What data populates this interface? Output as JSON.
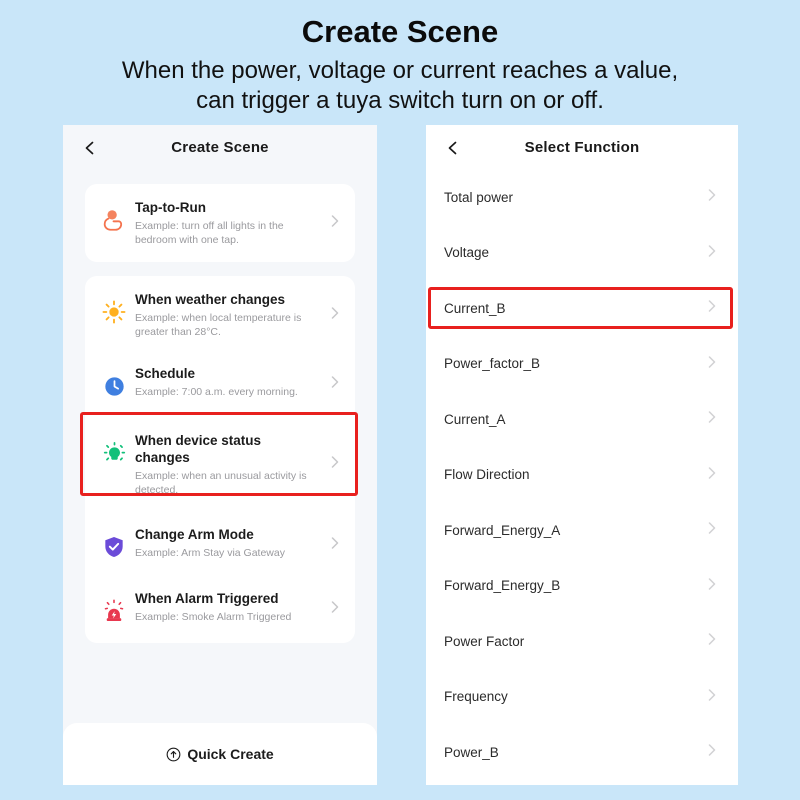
{
  "header": {
    "title": "Create Scene",
    "subtitle_line1": "When the power, voltage or current reaches a value,",
    "subtitle_line2": "can trigger a tuya switch turn on or off."
  },
  "colors": {
    "page_background": "#c9e6f9",
    "panel_background": "#f5f7fa",
    "card_background": "#ffffff",
    "highlight_red": "#e8201e",
    "tap_icon": "#f4734e",
    "weather_icon": "#ffb01f",
    "schedule_icon": "#3f7fe0",
    "device_icon": "#12c07a",
    "arm_icon": "#6b4bd8",
    "alarm_icon": "#e8384f",
    "title_text": "#1c1c1c",
    "desc_text": "#9a9a9e"
  },
  "left_panel": {
    "back_icon": "chevron-left-icon",
    "title": "Create Scene",
    "quick_create": {
      "label": "Quick Create",
      "icon": "arrow-up-circle-icon"
    },
    "scenes": [
      {
        "icon": "tap-hand-icon",
        "title": "Tap-to-Run",
        "desc": "Example: turn off all lights in the bedroom with one tap.",
        "highlighted": false
      },
      {
        "icon": "sun-icon",
        "title": "When weather changes",
        "desc": "Example: when local temperature is greater than 28°C.",
        "highlighted": false
      },
      {
        "icon": "clock-icon",
        "title": "Schedule",
        "desc": "Example: 7:00 a.m. every morning.",
        "highlighted": false
      },
      {
        "icon": "device-status-icon",
        "title": "When device status changes",
        "desc": "Example: when an unusual activity is detected.",
        "highlighted": true
      },
      {
        "icon": "shield-check-icon",
        "title": "Change Arm Mode",
        "desc": "Example: Arm Stay via Gateway",
        "highlighted": false
      },
      {
        "icon": "alarm-siren-icon",
        "title": "When Alarm Triggered",
        "desc": "Example: Smoke Alarm Triggered",
        "highlighted": false
      }
    ]
  },
  "right_panel": {
    "back_icon": "chevron-left-icon",
    "title": "Select Function",
    "functions": [
      {
        "label": "Total power",
        "highlighted": false
      },
      {
        "label": "Voltage",
        "highlighted": false
      },
      {
        "label": "Current_B",
        "highlighted": true
      },
      {
        "label": "Power_factor_B",
        "highlighted": false
      },
      {
        "label": "Current_A",
        "highlighted": false
      },
      {
        "label": "Flow Direction",
        "highlighted": false
      },
      {
        "label": "Forward_Energy_A",
        "highlighted": false
      },
      {
        "label": "Forward_Energy_B",
        "highlighted": false
      },
      {
        "label": "Power Factor",
        "highlighted": false
      },
      {
        "label": "Frequency",
        "highlighted": false
      },
      {
        "label": "Power_B",
        "highlighted": false
      }
    ]
  }
}
